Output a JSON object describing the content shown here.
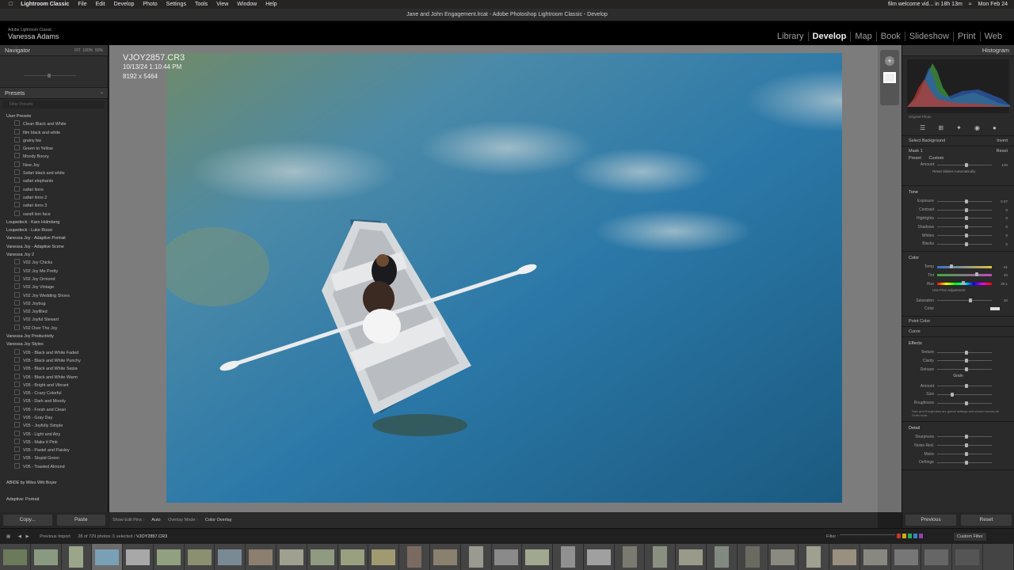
{
  "macbar": {
    "app": "Lightroom Classic",
    "menus": [
      "File",
      "Edit",
      "Develop",
      "Photo",
      "Settings",
      "Tools",
      "View",
      "Window",
      "Help"
    ],
    "notice": "film welcome vid... in 18h 13m",
    "datetime": "Mon Feb 24"
  },
  "window_title": "Jane and John Engagement.lrcat - Adobe Photoshop Lightroom Classic - Develop",
  "identity": {
    "brand": "Adobe Lightroom Classic",
    "user": "Vanessa Adams"
  },
  "modules": [
    "Library",
    "Develop",
    "Map",
    "Book",
    "Slideshow",
    "Print",
    "Web"
  ],
  "active_module": "Develop",
  "left": {
    "navigator": {
      "title": "Navigator",
      "zooms": [
        "FIT",
        "100%",
        "50%"
      ]
    },
    "presets": {
      "title": "Presets",
      "search_placeholder": "Filter Presets",
      "items": [
        {
          "t": "g",
          "label": "User Presets"
        },
        {
          "t": "p",
          "label": "Clean Black and White"
        },
        {
          "t": "p",
          "label": "film black and white"
        },
        {
          "t": "p",
          "label": "grainy bw"
        },
        {
          "t": "p",
          "label": "Green to Yellow"
        },
        {
          "t": "p",
          "label": "Moody Boozy"
        },
        {
          "t": "p",
          "label": "New Joy"
        },
        {
          "t": "p",
          "label": "Safari black and white"
        },
        {
          "t": "p",
          "label": "safari elephants"
        },
        {
          "t": "p",
          "label": "safari lions"
        },
        {
          "t": "p",
          "label": "safari lions 2"
        },
        {
          "t": "p",
          "label": "safari lions 3"
        },
        {
          "t": "p",
          "label": "sarafi lion face"
        },
        {
          "t": "g",
          "label": "Loupedeck - Karo Holmberg"
        },
        {
          "t": "g",
          "label": "Loupedeck - Luke Rossi"
        },
        {
          "t": "g",
          "label": "Vanessa Joy - Adaptive Portrait"
        },
        {
          "t": "g",
          "label": "Vanessa Joy - Adaptive Scene"
        },
        {
          "t": "g",
          "label": "Vanessa Joy 2"
        },
        {
          "t": "p",
          "label": "V02 Joy Chicks"
        },
        {
          "t": "p",
          "label": "V02 Joy Me Pretty"
        },
        {
          "t": "p",
          "label": "V02 Joy Ormond"
        },
        {
          "t": "p",
          "label": "V02 Joy Vintage"
        },
        {
          "t": "p",
          "label": "V02 Joy Wedding Shoes"
        },
        {
          "t": "p",
          "label": "V02 Joybug"
        },
        {
          "t": "p",
          "label": "V02 Joyfilled"
        },
        {
          "t": "p",
          "label": "V02 Joyful Stewart"
        },
        {
          "t": "p",
          "label": "V02 Over The Joy"
        },
        {
          "t": "g",
          "label": "Vanessa Joy Productivity"
        },
        {
          "t": "g",
          "label": "Vanessa Joy Styles"
        },
        {
          "t": "p",
          "label": "V05 - Black and White Faded"
        },
        {
          "t": "p",
          "label": "V05 - Black and White Punchy"
        },
        {
          "t": "p",
          "label": "V05 - Black and White Sepia"
        },
        {
          "t": "p",
          "label": "V05 - Black and White Warm"
        },
        {
          "t": "p",
          "label": "V05 - Bright and Vibrant"
        },
        {
          "t": "p",
          "label": "V05 - Crazy Colorful"
        },
        {
          "t": "p",
          "label": "V05 - Dark and Moody"
        },
        {
          "t": "p",
          "label": "V05 - Fresh and Clean"
        },
        {
          "t": "p",
          "label": "V05 - Gray Day"
        },
        {
          "t": "p",
          "label": "V05 - Joyfully Simple"
        },
        {
          "t": "p",
          "label": "V05 - Light and Airy"
        },
        {
          "t": "p",
          "label": "V05 - Make it Pink"
        },
        {
          "t": "p",
          "label": "V05 - Pastel and Paisley"
        },
        {
          "t": "p",
          "label": "V05 - Stupid Green"
        },
        {
          "t": "p",
          "label": "V05 - Toasted Almond"
        },
        {
          "t": "g",
          "label": ""
        },
        {
          "t": "g",
          "label": "ABIDE by Miles Witt Boyer"
        },
        {
          "t": "g",
          "label": ""
        },
        {
          "t": "g",
          "label": "Adaptive: Portrait"
        }
      ]
    },
    "copy": "Copy...",
    "paste": "Paste"
  },
  "photo": {
    "filename": "VJOY2857.CR3",
    "datetime": "10/13/24 1:10:44 PM",
    "dimensions": "8192 x 5464"
  },
  "toolbar": {
    "show_edit_pins": "Show Edit Pins :",
    "auto": "Auto",
    "overlay_mode": "Overlay Mode :",
    "overlay_value": "Color Overlay"
  },
  "right": {
    "histogram": "Histogram",
    "original_photo": "Original Photo",
    "mask_select": "Select Background",
    "invert": "Invert",
    "mask": "Mask 1",
    "reset": "Reset",
    "preset": "Preset",
    "custom": "Custom",
    "amount": "Amount",
    "amount_val": "100",
    "reset_sliders": "Reset Sliders Automatically",
    "tone_section": "Tone",
    "tone": [
      {
        "l": "Exposure",
        "v": "0.07",
        "p": 50
      },
      {
        "l": "Contrast",
        "v": "0",
        "p": 50
      },
      {
        "l": "Highlights",
        "v": "0",
        "p": 50
      },
      {
        "l": "Shadows",
        "v": "0",
        "p": 50
      },
      {
        "l": "Whites",
        "v": "0",
        "p": 50
      },
      {
        "l": "Blacks",
        "v": "0",
        "p": 50
      }
    ],
    "color_section": "Color",
    "color": [
      {
        "l": "Temp",
        "v": "-31",
        "p": 23
      },
      {
        "l": "Tint",
        "v": "40",
        "p": 70
      },
      {
        "l": "Hue",
        "v": "29.1",
        "p": 45
      }
    ],
    "use_fine": "Use Fine Adjustment",
    "saturation": {
      "l": "Saturation",
      "v": "20",
      "p": 58
    },
    "color_label": "Color",
    "point_color": "Point Color",
    "curve": "Curve",
    "effects": "Effects",
    "effects_sl": [
      {
        "l": "Texture",
        "v": "",
        "p": 50
      },
      {
        "l": "Clarity",
        "v": "",
        "p": 50
      },
      {
        "l": "Dehaze",
        "v": "",
        "p": 50
      }
    ],
    "grain": "Grain",
    "grain_sl": [
      {
        "l": "Amount",
        "v": "",
        "p": 50
      },
      {
        "l": "Size",
        "v": "",
        "p": 25
      },
      {
        "l": "Roughness",
        "v": "",
        "p": 50
      }
    ],
    "grain_note": "Size and Roughness are global settings and shared across all Grain tools",
    "detail": "Detail",
    "detail_sl": [
      {
        "l": "Sharpness",
        "v": "",
        "p": 50
      },
      {
        "l": "Noise Red.",
        "v": "",
        "p": 50
      },
      {
        "l": "Moire",
        "v": "",
        "p": 50
      },
      {
        "l": "Defringe",
        "v": "",
        "p": 50
      }
    ],
    "previous": "Previous",
    "reset_btn": "Reset"
  },
  "filmstrip": {
    "import": "Previous Import",
    "count": "28 of 729 photos /1 selected /",
    "file": "VJOY2857.CR3",
    "filter": "Filter :",
    "custom_filter": "Custom Filter"
  }
}
